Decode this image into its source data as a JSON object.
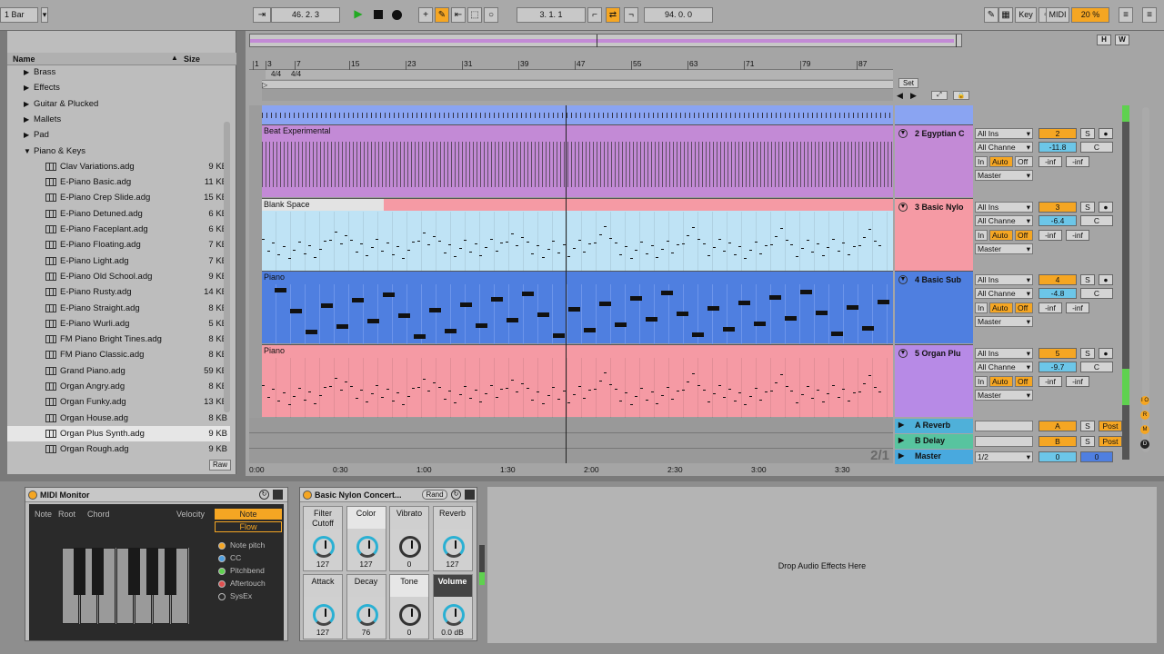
{
  "topbar": {
    "bar_select": "1 Bar",
    "position": "46.  2.  3",
    "loop_start": "3.  1.  1",
    "loop_length": "94.  0.  0",
    "key_label": "Key",
    "midi_label": "MIDI",
    "cpu": "20 %"
  },
  "browser": {
    "col_name": "Name",
    "col_size": "Size",
    "folders": [
      "Brass",
      "Effects",
      "Guitar & Plucked",
      "Mallets",
      "Pad",
      "Piano & Keys"
    ],
    "files": [
      {
        "name": "Clav Variations.adg",
        "size": "9 KB"
      },
      {
        "name": "E-Piano Basic.adg",
        "size": "11 KB"
      },
      {
        "name": "E-Piano Crep Slide.adg",
        "size": "15 KB"
      },
      {
        "name": "E-Piano Detuned.adg",
        "size": "6 KB"
      },
      {
        "name": "E-Piano Faceplant.adg",
        "size": "6 KB"
      },
      {
        "name": "E-Piano Floating.adg",
        "size": "7 KB"
      },
      {
        "name": "E-Piano Light.adg",
        "size": "7 KB"
      },
      {
        "name": "E-Piano Old School.adg",
        "size": "9 KB"
      },
      {
        "name": "E-Piano Rusty.adg",
        "size": "14 KB"
      },
      {
        "name": "E-Piano Straight.adg",
        "size": "8 KB"
      },
      {
        "name": "E-Piano Wurli.adg",
        "size": "5 KB"
      },
      {
        "name": "FM Piano Bright Tines.adg",
        "size": "8 KB"
      },
      {
        "name": "FM Piano Classic.adg",
        "size": "8 KB"
      },
      {
        "name": "Grand Piano.adg",
        "size": "59 KB"
      },
      {
        "name": "Organ Angry.adg",
        "size": "8 KB"
      },
      {
        "name": "Organ Funky.adg",
        "size": "13 KB"
      },
      {
        "name": "Organ House.adg",
        "size": "8 KB"
      },
      {
        "name": "Organ Plus Synth.adg",
        "size": "9 KB"
      },
      {
        "name": "Organ Rough.adg",
        "size": "9 KB"
      }
    ],
    "raw_button": "Raw"
  },
  "arrangement": {
    "bar_numbers": [
      "1",
      "3",
      "7",
      "15",
      "23",
      "31",
      "39",
      "47",
      "55",
      "63",
      "71",
      "79",
      "87"
    ],
    "time_sig": "4/4",
    "set_label": "Set",
    "time_labels": [
      "0:00",
      "0:30",
      "1:00",
      "1:30",
      "2:00",
      "2:30",
      "3:00",
      "3:30"
    ],
    "zoom_label": "2/1",
    "tracks": [
      {
        "clip": "Beat Experimental",
        "name": "2 Egyptian C",
        "input": "All Ins",
        "channel": "All Channe",
        "num": "2",
        "vol": "-11.8",
        "pan": "C",
        "color": "#c38ad6"
      },
      {
        "clip": "Blank Space",
        "name": "3 Basic Nylo",
        "input": "All Ins",
        "channel": "All Channe",
        "num": "3",
        "vol": "-6.4",
        "pan": "C",
        "color": "#f59aa4"
      },
      {
        "clip": "Piano",
        "name": "4 Basic Sub",
        "input": "All Ins",
        "channel": "All Channe",
        "num": "4",
        "vol": "-4.8",
        "pan": "C",
        "color": "#4f7fe0"
      },
      {
        "clip": "Piano",
        "name": "5 Organ Plu",
        "input": "All Ins",
        "channel": "All Channe",
        "num": "5",
        "vol": "-9.7",
        "pan": "C",
        "color": "#b78ae6"
      }
    ],
    "monitor": {
      "in": "In",
      "auto": "Auto",
      "off": "Off"
    },
    "output": "Master",
    "inf": "-inf",
    "returns": [
      {
        "name": "A Reverb",
        "letter": "A",
        "post": "Post"
      },
      {
        "name": "B Delay",
        "letter": "B",
        "post": "Post"
      }
    ],
    "master": {
      "name": "Master",
      "cue": "1/2",
      "vol": "0",
      "pan": "0"
    }
  },
  "midi_monitor": {
    "title": "MIDI Monitor",
    "cols": [
      "Note",
      "Root",
      "Chord",
      "Velocity"
    ],
    "note_btn": "Note",
    "flow_btn": "Flow",
    "legend": [
      "Note pitch",
      "CC",
      "Pitchbend",
      "Aftertouch",
      "SysEx"
    ]
  },
  "rack": {
    "title": "Basic Nylon Concert...",
    "rand": "Rand",
    "macros": [
      {
        "label": "Filter Cutoff",
        "value": "127"
      },
      {
        "label": "Color",
        "value": "127"
      },
      {
        "label": "Vibrato",
        "value": "0"
      },
      {
        "label": "Reverb",
        "value": "127"
      },
      {
        "label": "Attack",
        "value": "127"
      },
      {
        "label": "Decay",
        "value": "76"
      },
      {
        "label": "Tone",
        "value": "0"
      },
      {
        "label": "Volume",
        "value": "0.0 dB"
      }
    ]
  },
  "drop_zone": "Drop Audio Effects Here"
}
